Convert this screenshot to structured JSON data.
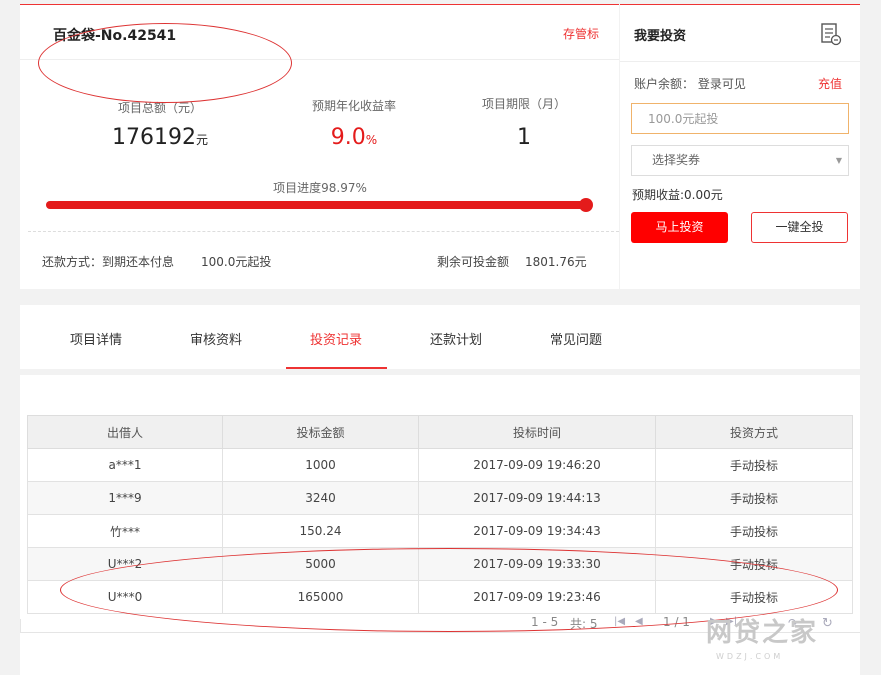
{
  "project": {
    "title": "百金袋-No.42541",
    "save_link": "存管标",
    "stats": [
      {
        "label": "项目总额（元）",
        "value": "176192",
        "unit": "元"
      },
      {
        "label": "预期年化收益率",
        "value": "9.0",
        "unit": "%"
      },
      {
        "label": "项目期限（月）",
        "value": "1",
        "unit": ""
      }
    ],
    "progress_label": "项目进度98.97%",
    "progress_fraction": 0.9897,
    "repay_method": "还款方式：到期还本付息",
    "min_invest": "100.0元起投",
    "remaining_label": "剩余可投金额",
    "remaining_value": "1801.76元"
  },
  "invest": {
    "title": "我要投资",
    "balance_label": "账户余额：",
    "balance_value": "登录可见",
    "recharge": "充值",
    "amount_placeholder": "100.0元起投",
    "coupon_placeholder": "选择奖券",
    "expected_income": "预期收益:0.00元",
    "invest_button": "马上投资",
    "invest_all_button": "一键全投"
  },
  "tabs": [
    "项目详情",
    "审核资料",
    "投资记录",
    "还款计划",
    "常见问题"
  ],
  "active_tab": 2,
  "records": {
    "headers": [
      "出借人",
      "投标金额",
      "投标时间",
      "投资方式"
    ],
    "rows": [
      [
        "a***1",
        "1000",
        "2017-09-09 19:46:20",
        "手动投标"
      ],
      [
        "1***9",
        "3240",
        "2017-09-09 19:44:13",
        "手动投标"
      ],
      [
        "竹***",
        "150.24",
        "2017-09-09 19:34:43",
        "手动投标"
      ],
      [
        "U***2",
        "5000",
        "2017-09-09 19:33:30",
        "手动投标"
      ],
      [
        "U***0",
        "165000",
        "2017-09-09 19:23:46",
        "手动投标"
      ]
    ]
  },
  "pager": {
    "range": "1 - 5",
    "total": "共: 5",
    "page": "1 / 1"
  },
  "watermark": {
    "main": "网贷之家",
    "sub": "WDZJ.COM"
  },
  "colors": {
    "accent": "#e41b1b",
    "input_border": "#f0b36b"
  }
}
